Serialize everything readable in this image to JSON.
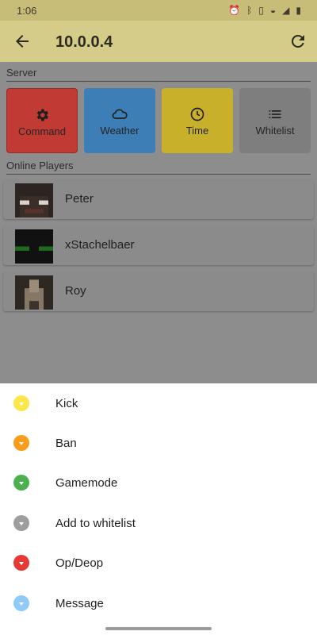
{
  "status_bar": {
    "time": "1:06",
    "icons": [
      "alarm-icon",
      "bluetooth-icon",
      "vibrate-icon",
      "wifi-icon",
      "signal-icon",
      "battery-icon"
    ]
  },
  "app_bar": {
    "title": "10.0.0.4",
    "back_icon": "arrow-back-icon",
    "refresh_icon": "refresh-icon"
  },
  "server_section": {
    "label": "Server",
    "tiles": [
      {
        "label": "Command",
        "icon": "gear-icon",
        "color": "#c13a33"
      },
      {
        "label": "Weather",
        "icon": "cloud-icon",
        "color": "#3d7eb6"
      },
      {
        "label": "Time",
        "icon": "clock-icon",
        "color": "#c9b02b"
      },
      {
        "label": "Whitelist",
        "icon": "list-icon",
        "color": "#7e7e7e"
      }
    ]
  },
  "players_section": {
    "label": "Online Players",
    "players": [
      {
        "name": "Peter"
      },
      {
        "name": "xStachelbaer"
      },
      {
        "name": "Roy"
      }
    ]
  },
  "actions_sheet": {
    "items": [
      {
        "label": "Kick",
        "color": "#fbe74a"
      },
      {
        "label": "Ban",
        "color": "#f89c1a"
      },
      {
        "label": "Gamemode",
        "color": "#4caf50"
      },
      {
        "label": "Add to whitelist",
        "color": "#9e9e9e"
      },
      {
        "label": "Op/Deop",
        "color": "#e53935"
      },
      {
        "label": "Message",
        "color": "#90caf9"
      }
    ]
  }
}
